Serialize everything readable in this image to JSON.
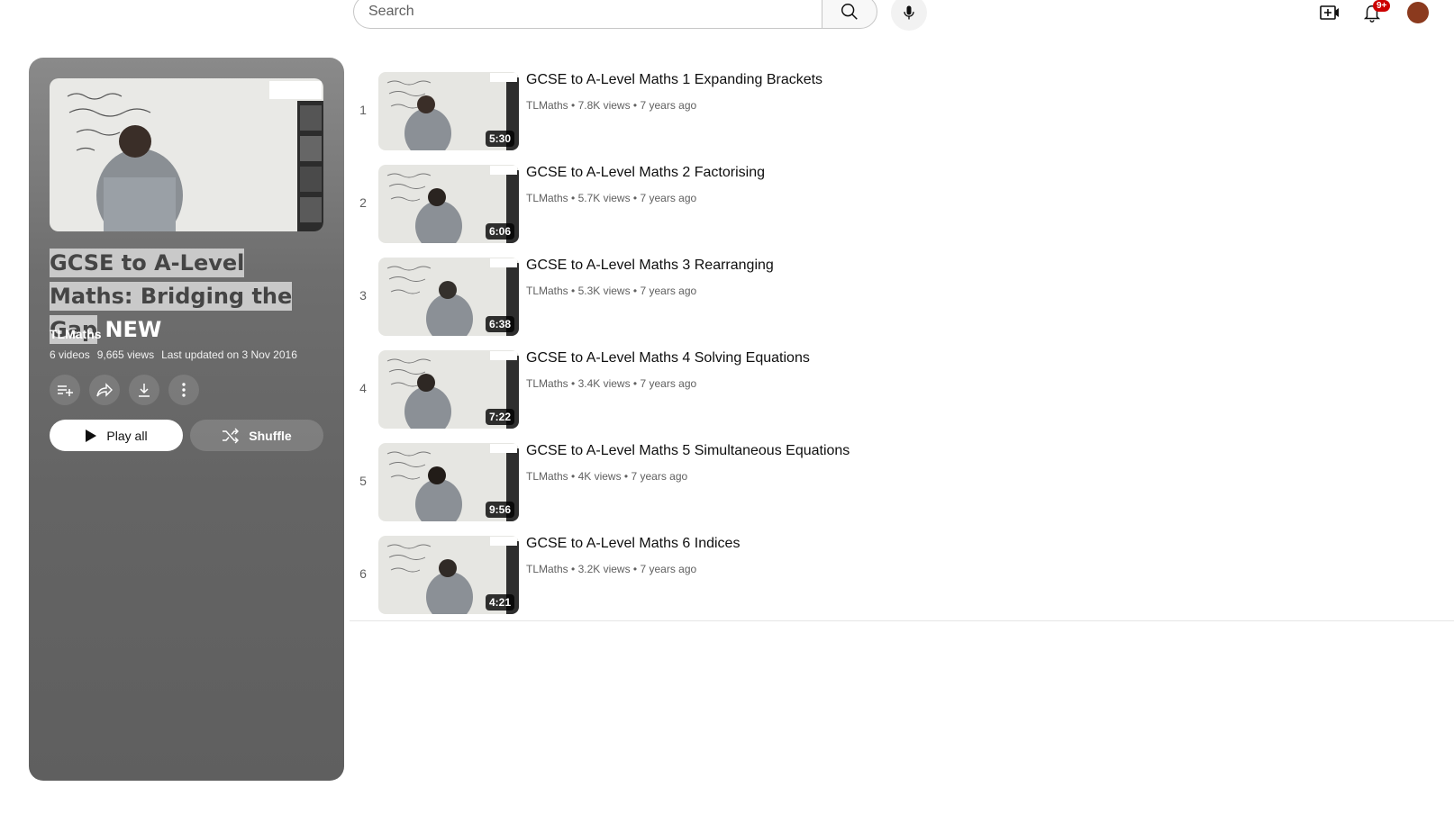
{
  "header": {
    "search_placeholder": "Search",
    "notification_badge": "9+"
  },
  "playlist": {
    "title": "GCSE to A-Level Maths: Bridging the Gap",
    "title_tag": "NEW",
    "owner": "TLMaths",
    "video_count": "6 videos",
    "views": "9,665 views",
    "updated": "Last updated on 3 Nov 2016",
    "play_all_label": "Play all",
    "shuffle_label": "Shuffle"
  },
  "videos": [
    {
      "index": "1",
      "title": "GCSE to A-Level Maths 1 Expanding Brackets",
      "channel": "TLMaths",
      "views": "7.8K views",
      "age": "7 years ago",
      "duration": "5:30"
    },
    {
      "index": "2",
      "title": "GCSE to A-Level Maths 2 Factorising",
      "channel": "TLMaths",
      "views": "5.7K views",
      "age": "7 years ago",
      "duration": "6:06"
    },
    {
      "index": "3",
      "title": "GCSE to A-Level Maths 3 Rearranging",
      "channel": "TLMaths",
      "views": "5.3K views",
      "age": "7 years ago",
      "duration": "6:38"
    },
    {
      "index": "4",
      "title": "GCSE to A-Level Maths 4 Solving Equations",
      "channel": "TLMaths",
      "views": "3.4K views",
      "age": "7 years ago",
      "duration": "7:22"
    },
    {
      "index": "5",
      "title": "GCSE to A-Level Maths 5 Simultaneous Equations",
      "channel": "TLMaths",
      "views": "4K views",
      "age": "7 years ago",
      "duration": "9:56"
    },
    {
      "index": "6",
      "title": "GCSE to A-Level Maths 6 Indices",
      "channel": "TLMaths",
      "views": "3.2K views",
      "age": "7 years ago",
      "duration": "4:21"
    }
  ],
  "colors": {
    "panel_bg": "#6e6e6e",
    "badge": "#cc0000",
    "text_primary": "#0f0f0f",
    "text_secondary": "#606060"
  }
}
